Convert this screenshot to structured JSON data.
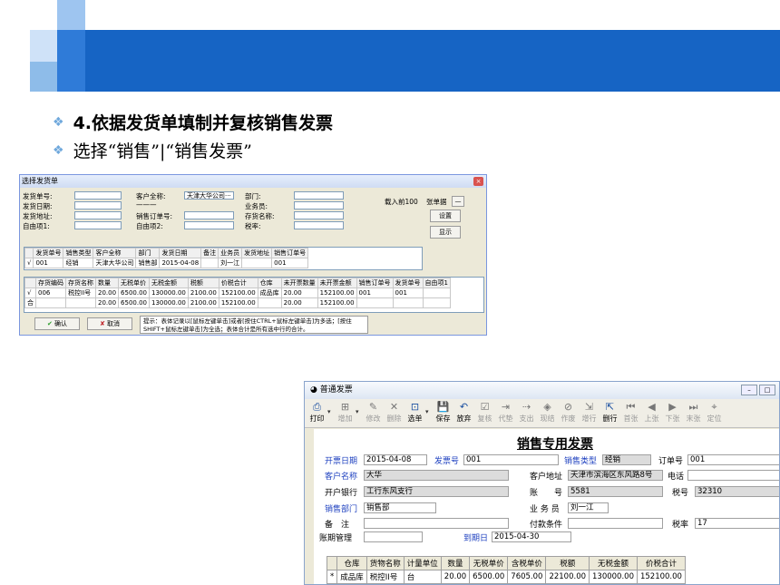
{
  "slide": {
    "bullet1": "4.依据发货单填制并复核销售发票",
    "bullet2": "选择“销售”|“销售发票”"
  },
  "dlg": {
    "title": "选择发货单",
    "close": "×",
    "labels": {
      "ship_no": "发货单号:",
      "ship_date": "发货日期:",
      "ship_addr": "发货地址:",
      "custom1": "自由项1:",
      "customer": "客户全称:",
      "so_no": "销售订单号:",
      "custom2": "自由项2:",
      "dept": "部门:",
      "salesman": "业务员:",
      "stock": "存货名称:",
      "tax": "税率:",
      "load_top": "载入前100",
      "bill_count": "张单据",
      "dash": "—"
    },
    "customer_value": "天津大华公司···",
    "customer_dash": "———",
    "btn_settings": "设置",
    "btn_show": "显示",
    "btn_ok": "确认",
    "btn_cancel": "取消",
    "grid1": {
      "headers": [
        "",
        "发货单号",
        "销售类型",
        "客户全称",
        "部门",
        "发货日期",
        "备注",
        "业务员",
        "发货地址",
        "销售订单号"
      ],
      "rows": [
        [
          "√",
          "001",
          "经销",
          "天津大华公司",
          "销售部",
          "2015-04-08",
          "",
          "刘一江",
          "",
          "001"
        ]
      ]
    },
    "grid2": {
      "headers": [
        "",
        "存货编码",
        "存货名称",
        "数量",
        "无税单价",
        "无税金额",
        "税额",
        "价税合计",
        "仓库",
        "未开票数量",
        "未开票金额",
        "销售订单号",
        "发货单号",
        "自由项1"
      ],
      "rows": [
        [
          "√",
          "006",
          "税控II号",
          "20.00",
          "6500.00",
          "130000.00",
          "2100.00",
          "152100.00",
          "成品库",
          "20.00",
          "152100.00",
          "001",
          "001",
          ""
        ],
        [
          "合",
          "",
          "",
          "20.00",
          "6500.00",
          "130000.00",
          "2100.00",
          "152100.00",
          "",
          "20.00",
          "152100.00",
          "",
          "",
          ""
        ]
      ]
    },
    "tip": "提示：表体记录以[鼠标左键单击]或者[按住CTRL+鼠标左键单击]为多选；[按住SHIFT+鼠标左键单击]为全选；表体合计是所有选中行的合计。"
  },
  "win": {
    "title": "普通发票",
    "toolbar": [
      "打印",
      "增加",
      "修改",
      "删除",
      "选单",
      "保存",
      "放弃",
      "复核",
      "代垫",
      "支出",
      "现结",
      "作废",
      "增行",
      "删行",
      "首张",
      "上张",
      "下张",
      "末张",
      "定位"
    ],
    "toolbar_icons": [
      "printer-icon",
      "add-icon",
      "edit-icon",
      "delete-icon",
      "select-icon",
      "save-icon",
      "undo-icon",
      "review-icon",
      "advance-icon",
      "expense-icon",
      "cash-icon",
      "void-icon",
      "add-row-icon",
      "delete-row-icon",
      "first-icon",
      "prev-icon",
      "next-icon",
      "last-icon",
      "locate-icon"
    ],
    "form_title": "销售专用发票",
    "l": {
      "date": "开票日期",
      "inv_no": "发票号",
      "sales_type": "销售类型",
      "order_no": "订单号",
      "cust_name": "客户名称",
      "cust_addr": "客户地址",
      "phone": "电话",
      "bank": "开户银行",
      "account": "账　　号",
      "tax_no": "税号",
      "dept": "销售部门",
      "salesman": "业 务 员",
      "note": "备　注",
      "pay": "付款条件",
      "tax_rate": "税率",
      "period": "账期管理",
      "due": "到期日"
    },
    "v": {
      "date": "2015-04-08",
      "inv_no": "001",
      "sales_type": "经销",
      "order_no": "001",
      "cust_name": "大华",
      "cust_addr": "天津市滨海区东风路8号",
      "phone": "",
      "bank": "工行东风支行",
      "account": "5581",
      "tax_no": "32310",
      "dept": "销售部",
      "salesman": "刘一江",
      "note": "",
      "pay": "",
      "tax_rate": "17",
      "period": "",
      "due": "2015-04-30"
    },
    "table": {
      "headers": [
        "",
        "仓库",
        "货物名称",
        "计量单位",
        "数量",
        "无税单价",
        "含税单价",
        "税额",
        "无税金额",
        "价税合计"
      ],
      "rows": [
        [
          "*",
          "成品库",
          "税控II号",
          "台",
          "20.00",
          "6500.00",
          "7605.00",
          "22100.00",
          "130000.00",
          "152100.00"
        ]
      ]
    }
  }
}
